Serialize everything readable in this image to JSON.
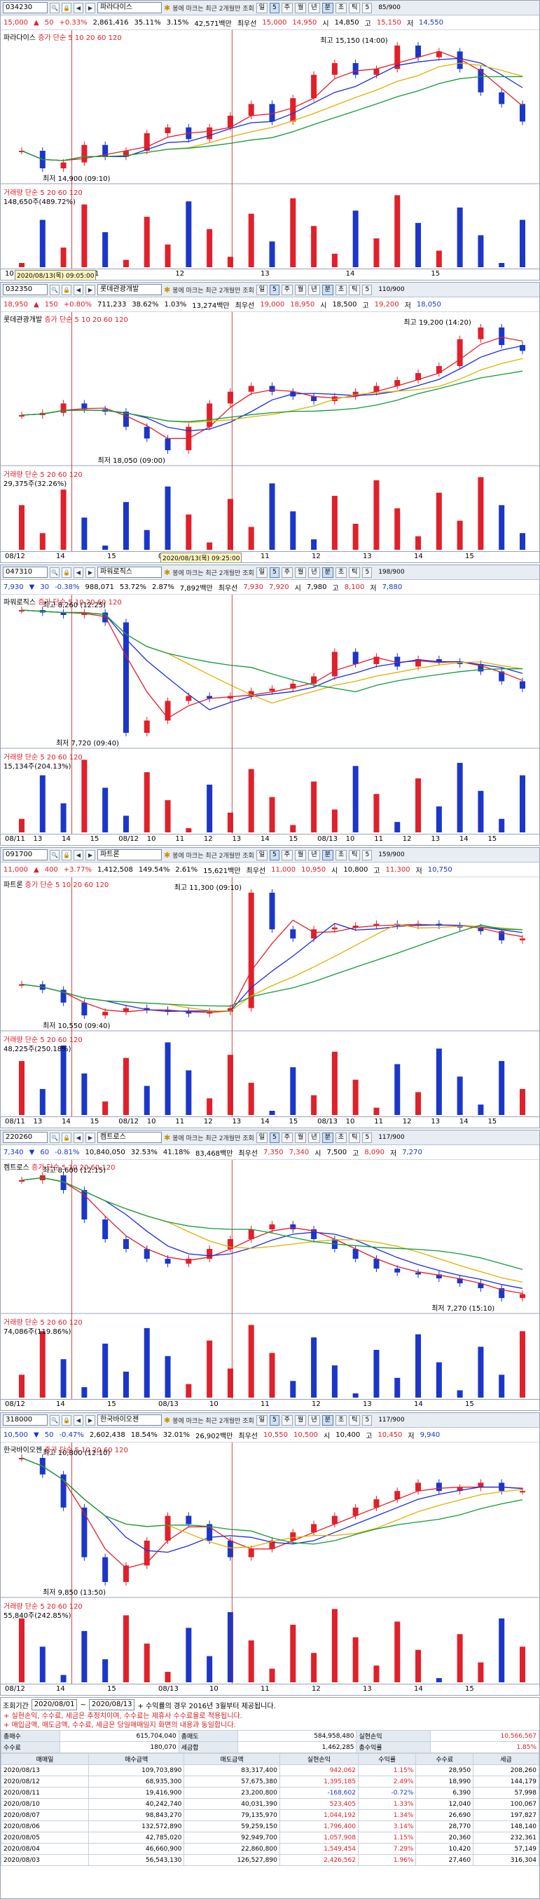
{
  "toolbar_common": {
    "note": "봉에 마크는 최근 2개월만 조회",
    "periods": [
      "일",
      "주",
      "월",
      "년",
      "분",
      "초",
      "틱"
    ],
    "interval": "5",
    "legend_price": "증가 단순 5 10 20 60 120",
    "legend_ma": [
      "5",
      "10",
      "20",
      "60",
      "120"
    ],
    "legend_volume": "거래량 단순 5 20 60 120"
  },
  "charts": [
    {
      "code": "034230",
      "name": "파라다이스",
      "count": "85/900",
      "quote": [
        "15,000",
        "▲",
        "50",
        "+0.33%",
        "2,861,416",
        "35.11%",
        "3.15%",
        "42,571백만",
        "최우선",
        "15,000",
        "14,950",
        "시",
        "14,850",
        "고",
        "15,150",
        "저",
        "14,550"
      ],
      "high_label": "최고 15,150 (14:00)",
      "low_label": "최저 14,900 (09:10)",
      "vol_label": "148,650주(489.72%)",
      "tooltip": "2020/08/13(목) 09:05:00",
      "xlabels": [
        "10",
        "11",
        "12",
        "13",
        "14",
        "15"
      ],
      "closes": [
        14950,
        14920,
        14930,
        14960,
        14940,
        14950,
        14980,
        14990,
        14970,
        14990,
        15010,
        15030,
        15000,
        15040,
        15080,
        15100,
        15080,
        15090,
        15130,
        15110,
        15120,
        15090,
        15050,
        15030,
        15000
      ]
    },
    {
      "code": "032350",
      "name": "롯데관광개발",
      "count": "110/900",
      "quote": [
        "18,950",
        "▲",
        "150",
        "+0.80%",
        "711,233",
        "38.62%",
        "1.03%",
        "13,274백만",
        "최우선",
        "19,000",
        "18,950",
        "시",
        "18,500",
        "고",
        "19,200",
        "저",
        "18,050"
      ],
      "high_label": "최고 19,200 (14:20)",
      "low_label": "최저 18,050 (09:00)",
      "vol_label": "29,375주(32.26%)",
      "tooltip": "2020/08/13(목) 09:25:00",
      "xlabels": [
        "08/12",
        "14",
        "15",
        "09",
        "10",
        "11",
        "12",
        "13",
        "14",
        "15"
      ],
      "closes": [
        18400,
        18420,
        18500,
        18450,
        18430,
        18300,
        18200,
        18100,
        18300,
        18500,
        18600,
        18650,
        18600,
        18560,
        18520,
        18560,
        18600,
        18650,
        18700,
        18760,
        18820,
        19050,
        19150,
        19000,
        18950
      ]
    },
    {
      "code": "047310",
      "name": "파워로직스",
      "count": "198/900",
      "quote": [
        "7,930",
        "▼",
        "30",
        "-0.38%",
        "988,071",
        "53.72%",
        "2.87%",
        "7,892백만",
        "최우선",
        "7,930",
        "7,920",
        "시",
        "7,980",
        "고",
        "8,100",
        "저",
        "7,880"
      ],
      "high_label": "최고 8,260 (12:25)",
      "low_label": "최저 7,720 (09:40)",
      "vol_label": "15,134주(204.13%)",
      "tooltip": "",
      "xlabels": [
        "08/11",
        "13",
        "14",
        "15",
        "08/12",
        "10",
        "11",
        "12",
        "13",
        "14",
        "15",
        "08/13",
        "10",
        "11",
        "12",
        "13",
        "14",
        "15"
      ],
      "closes": [
        8250,
        8240,
        8230,
        8240,
        8200,
        7750,
        7800,
        7880,
        7900,
        7890,
        7900,
        7920,
        7930,
        7950,
        7980,
        8080,
        8030,
        8060,
        8020,
        8050,
        8040,
        8030,
        8000,
        7960,
        7930
      ]
    },
    {
      "code": "091700",
      "name": "파트론",
      "count": "159/900",
      "quote": [
        "11,000",
        "▲",
        "400",
        "+3.77%",
        "1,412,508",
        "149.54%",
        "2.61%",
        "15,621백만",
        "최우선",
        "11,000",
        "10,950",
        "시",
        "10,800",
        "고",
        "11,300",
        "저",
        "10,750"
      ],
      "high_label": "최고 11,300 (09:10)",
      "low_label": "최저 10,550 (09:40)",
      "vol_label": "48,225주(250.18%)",
      "tooltip": "",
      "xlabels": [
        "08/11",
        "13",
        "14",
        "15",
        "08/12",
        "10",
        "11",
        "12",
        "13",
        "14",
        "15",
        "08/13",
        "10",
        "11",
        "12",
        "13",
        "14",
        "15"
      ],
      "closes": [
        10750,
        10720,
        10650,
        10580,
        10600,
        10620,
        10610,
        10600,
        10590,
        10600,
        10620,
        11250,
        11050,
        11000,
        11050,
        11060,
        11070,
        11080,
        11070,
        11080,
        11070,
        11060,
        11040,
        10990,
        11000
      ]
    },
    {
      "code": "220260",
      "name": "켐트로스",
      "count": "117/900",
      "quote": [
        "7,340",
        "▼",
        "60",
        "-0.81%",
        "10,840,050",
        "32.53%",
        "41.18%",
        "83,468백만",
        "최우선",
        "7,350",
        "7,340",
        "시",
        "7,500",
        "고",
        "8,090",
        "저",
        "7,270"
      ],
      "high_label": "최고 8,600 (12:15)",
      "low_label": "최저 7,270 (15:10)",
      "vol_label": "74,086주(119.86%)",
      "tooltip": "",
      "xlabels": [
        "08/12",
        "14",
        "15",
        "08/13",
        "10",
        "11",
        "12",
        "13",
        "14",
        "15"
      ],
      "closes": [
        8500,
        8550,
        8400,
        8100,
        7900,
        7800,
        7700,
        7650,
        7700,
        7800,
        7900,
        8000,
        8050,
        8000,
        7900,
        7800,
        7700,
        7600,
        7560,
        7540,
        7500,
        7450,
        7400,
        7300,
        7340
      ]
    },
    {
      "code": "318000",
      "name": "한국바이오젠",
      "count": "117/900",
      "quote": [
        "10,500",
        "▼",
        "50",
        "-0.47%",
        "2,602,438",
        "18.54%",
        "32.01%",
        "26,902백만",
        "최우선",
        "10,550",
        "10,500",
        "시",
        "10,400",
        "고",
        "10,450",
        "저",
        "9,940"
      ],
      "high_label": "최고 10,800 (12:10)",
      "low_label": "최저 9,850 (13:50)",
      "vol_label": "55,840주(242.85%)",
      "tooltip": "",
      "xlabels": [
        "08/12",
        "14",
        "15",
        "08/13",
        "10",
        "11",
        "12",
        "13",
        "14",
        "15"
      ],
      "closes": [
        10700,
        10600,
        10400,
        10100,
        9950,
        10050,
        10200,
        10350,
        10300,
        10200,
        10100,
        10150,
        10200,
        10250,
        10300,
        10350,
        10400,
        10450,
        10500,
        10550,
        10500,
        10520,
        10550,
        10500,
        10500
      ]
    }
  ],
  "pl": {
    "label_period": "조회기간",
    "date_from": "2020/08/01",
    "date_to": "2020/08/13",
    "info": "+ 수익률의 경우 2016년 3월부터 제공됩니다.",
    "notes": [
      "+ 실현손익, 수수료, 세금은 추정치이며, 수수료는 제휴사 수수료율로 적용됩니다.",
      "+ 매입금액, 매도금액, 수수료, 세금은 당일매매일지 화면의 내용과 동일합니다."
    ],
    "summary": [
      [
        "총매수",
        "615,704,040",
        "총매도",
        "584,958,480",
        "실현손익",
        "10,566,567"
      ],
      [
        "수수료",
        "180,070",
        "세금합",
        "1,462,285",
        "총수익률",
        "1.85%"
      ]
    ],
    "headers": [
      "매매일",
      "매수금액",
      "매도금액",
      "실현손익",
      "수익률",
      "수수료",
      "세금"
    ],
    "rows": [
      [
        "2020/08/13",
        "109,703,890",
        "83,317,400",
        "942,062",
        "1.15%",
        "28,950",
        "208,260"
      ],
      [
        "2020/08/12",
        "68,935,300",
        "57,675,380",
        "1,395,185",
        "2.49%",
        "18,990",
        "144,179"
      ],
      [
        "2020/08/11",
        "19,416,900",
        "23,200,800",
        "-168,602",
        "-0.72%",
        "6,390",
        "57,998"
      ],
      [
        "2020/08/10",
        "40,242,740",
        "40,031,390",
        "523,405",
        "1.33%",
        "12,040",
        "100,067"
      ],
      [
        "2020/08/07",
        "98,843,270",
        "79,135,970",
        "1,044,192",
        "1.34%",
        "26,690",
        "197,827"
      ],
      [
        "2020/08/06",
        "132,572,890",
        "59,259,150",
        "1,796,400",
        "3.14%",
        "28,770",
        "148,140"
      ],
      [
        "2020/08/05",
        "42,785,020",
        "92,949,700",
        "1,057,908",
        "1.15%",
        "20,360",
        "232,361"
      ],
      [
        "2020/08/04",
        "46,660,900",
        "22,860,800",
        "1,549,454",
        "7.29%",
        "10,420",
        "57,149"
      ],
      [
        "2020/08/03",
        "56,543,130",
        "126,527,890",
        "2,426,562",
        "1.96%",
        "27,460",
        "316,304"
      ]
    ]
  },
  "colors": {
    "up": "#e0202a",
    "down": "#1b36c8",
    "ma5": "#e0202a",
    "ma10": "#1a2de0",
    "ma20": "#e0b000",
    "ma60": "#139a3c",
    "ma120": "#8a8a8a"
  }
}
